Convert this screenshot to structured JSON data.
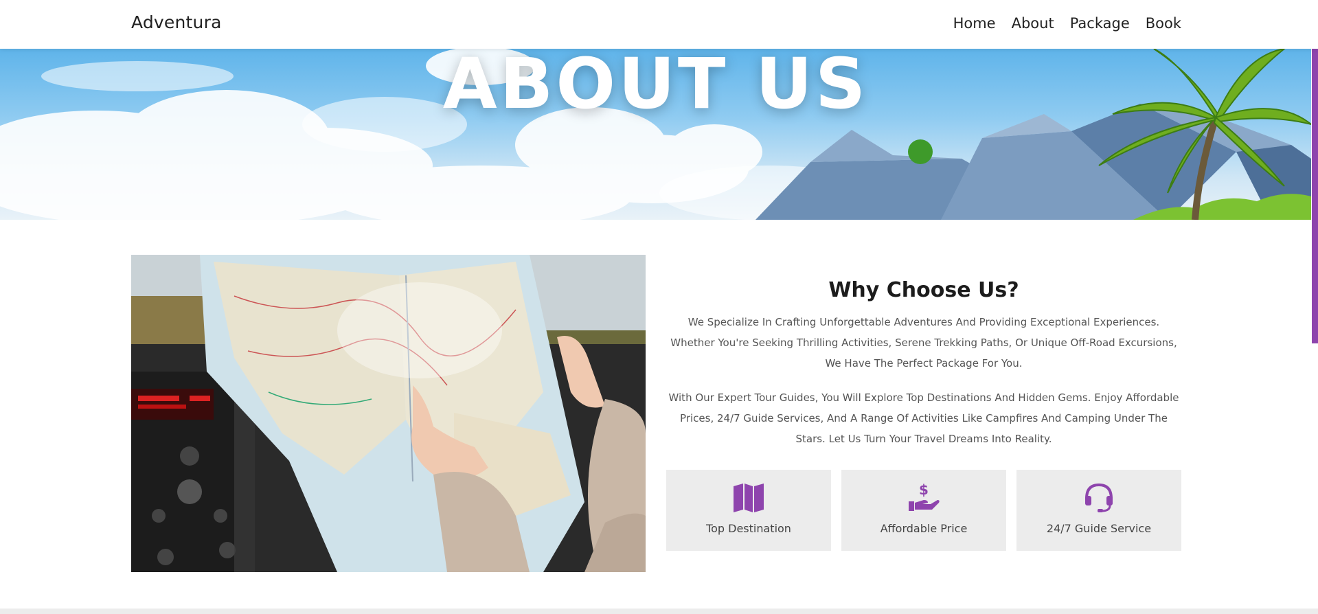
{
  "nav": {
    "brand": "Adventura",
    "links": [
      "Home",
      "About",
      "Package",
      "Book"
    ]
  },
  "hero": {
    "title": "ABOUT US"
  },
  "why": {
    "title": "Why Choose Us?",
    "paragraph1": "We Specialize In Crafting Unforgettable Adventures And Providing Exceptional Experiences. Whether You're Seeking Thrilling Activities, Serene Trekking Paths, Or Unique Off-Road Excursions, We Have The Perfect Package For You.",
    "paragraph2": "With Our Expert Tour Guides, You Will Explore Top Destinations And Hidden Gems. Enjoy Affordable Prices, 24/7 Guide Services, And A Range Of Activities Like Campfires And Camping Under The Stars. Let Us Turn Your Travel Dreams Into Reality."
  },
  "features": [
    {
      "label": "Top Destination",
      "icon": "map-icon"
    },
    {
      "label": "Affordable Price",
      "icon": "hand-dollar-icon"
    },
    {
      "label": "24/7 Guide Service",
      "icon": "headset-icon"
    }
  ],
  "colors": {
    "accent": "#8e44ad",
    "feature_bg": "#ececec",
    "text_muted": "#555555"
  }
}
